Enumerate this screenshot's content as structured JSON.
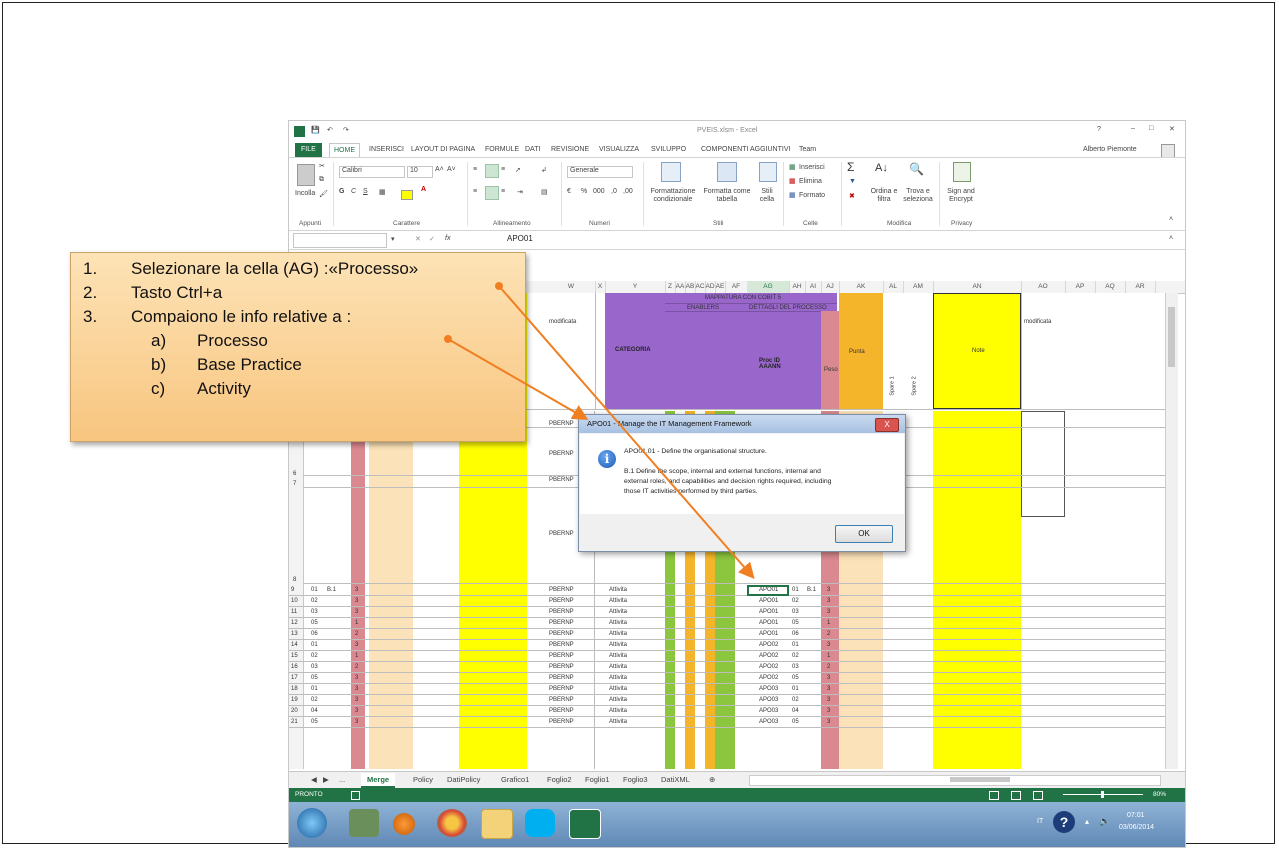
{
  "callout": {
    "items": [
      {
        "num": "1.",
        "text": "Selezionare la cella (AG) :«Processo»"
      },
      {
        "num": "2.",
        "text": "Tasto Ctrl+a"
      },
      {
        "num": "3.",
        "text": "Compaiono le info relative a :"
      }
    ],
    "subitems": [
      {
        "letter": "a)",
        "text": "Processo"
      },
      {
        "letter": "b)",
        "text": "Base Practice"
      },
      {
        "letter": "c)",
        "text": "Activity"
      }
    ]
  },
  "excel": {
    "window_title": "PVEIS.xlsm - Excel",
    "user": "Alberto Piemonte",
    "ribbon_tabs": [
      "FILE",
      "HOME",
      "INSERISCI",
      "LAYOUT DI PAGINA",
      "FORMULE",
      "DATI",
      "REVISIONE",
      "VISUALIZZA",
      "SVILUPPO",
      "COMPONENTI AGGIUNTIVI",
      "Team"
    ],
    "font_name": "Calibri",
    "font_size": "10",
    "number_format": "Generale",
    "group_labels": [
      "Appunti",
      "Carattere",
      "Allineamento",
      "Numeri",
      "Stili",
      "Celle",
      "Modifica",
      "Privacy"
    ],
    "ribbon_buttons": {
      "paste": "Incolla",
      "conditional": "Formattazione condizionale",
      "format_table": "Formatta come tabella",
      "cell_styles": "Stili cella",
      "insert": "Inserisci",
      "delete": "Elimina",
      "format": "Formato",
      "sort": "Ordina e filtra",
      "find": "Trova e seleziona",
      "sign": "Sign and Encrypt"
    },
    "name_box": "",
    "formula": "APO01",
    "fx": "fx",
    "columns": [
      "W",
      "X",
      "Y",
      "Z",
      "AA",
      "AB",
      "AC",
      "AD",
      "AE",
      "AF",
      "AG",
      "AH",
      "AI",
      "AJ",
      "AK",
      "AL",
      "AM",
      "AN",
      "AO",
      "AP",
      "AQ",
      "AR"
    ],
    "header_labels": {
      "mappatura": "MAPPATURA CON COBIT 5",
      "enablers": "ENABLERS",
      "dettagli": "DETTAGLI DEL PROCESSO",
      "modificata1": "modificata",
      "categoria": "CATEGORIA",
      "proc_id": "Proc ID AAANN",
      "peso": "Peso",
      "punta": "Punta",
      "note": "Note",
      "modificata2": "modificata",
      "spare1": "Spare 1",
      "spare2": "Spare 2"
    },
    "rows": [
      {
        "n": "9",
        "a": "01",
        "b": "B.1",
        "c": "3",
        "w": "PBERNP",
        "y": "Attivita",
        "ag": "APO01",
        "ah": "01",
        "ai": "B.1",
        "aj": "3"
      },
      {
        "n": "10",
        "a": "02",
        "b": "",
        "c": "3",
        "w": "PBERNP",
        "y": "Attivita",
        "ag": "APO01",
        "ah": "02",
        "ai": "",
        "aj": "3"
      },
      {
        "n": "11",
        "a": "03",
        "b": "",
        "c": "3",
        "w": "PBERNP",
        "y": "Attivita",
        "ag": "APO01",
        "ah": "03",
        "ai": "",
        "aj": "3"
      },
      {
        "n": "12",
        "a": "05",
        "b": "",
        "c": "1",
        "w": "PBERNP",
        "y": "Attivita",
        "ag": "APO01",
        "ah": "05",
        "ai": "",
        "aj": "1"
      },
      {
        "n": "13",
        "a": "06",
        "b": "",
        "c": "2",
        "w": "PBERNP",
        "y": "Attivita",
        "ag": "APO01",
        "ah": "06",
        "ai": "",
        "aj": "2"
      },
      {
        "n": "14",
        "a": "01",
        "b": "",
        "c": "3",
        "w": "PBERNP",
        "y": "Attivita",
        "ag": "APO02",
        "ah": "01",
        "ai": "",
        "aj": "3"
      },
      {
        "n": "15",
        "a": "02",
        "b": "",
        "c": "1",
        "w": "PBERNP",
        "y": "Attivita",
        "ag": "APO02",
        "ah": "02",
        "ai": "",
        "aj": "1"
      },
      {
        "n": "16",
        "a": "03",
        "b": "",
        "c": "2",
        "w": "PBERNP",
        "y": "Attivita",
        "ag": "APO02",
        "ah": "03",
        "ai": "",
        "aj": "2"
      },
      {
        "n": "17",
        "a": "05",
        "b": "",
        "c": "3",
        "w": "PBERNP",
        "y": "Attivita",
        "ag": "APO02",
        "ah": "05",
        "ai": "",
        "aj": "3"
      },
      {
        "n": "18",
        "a": "01",
        "b": "",
        "c": "3",
        "w": "PBERNP",
        "y": "Attivita",
        "ag": "APO03",
        "ah": "01",
        "ai": "",
        "aj": "3"
      },
      {
        "n": "19",
        "a": "02",
        "b": "",
        "c": "3",
        "w": "PBERNP",
        "y": "Attivita",
        "ag": "APO03",
        "ah": "02",
        "ai": "",
        "aj": "3"
      },
      {
        "n": "20",
        "a": "04",
        "b": "",
        "c": "3",
        "w": "PBERNP",
        "y": "Attivita",
        "ag": "APO03",
        "ah": "04",
        "ai": "",
        "aj": "3"
      },
      {
        "n": "21",
        "a": "05",
        "b": "",
        "c": "3",
        "w": "PBERNP",
        "y": "Attivita",
        "ag": "APO03",
        "ah": "05",
        "ai": "",
        "aj": "3"
      }
    ],
    "upper_row_numbers": [
      "6",
      "7",
      "8"
    ],
    "upper_w": [
      "PBERNP",
      "PBERNP",
      "PBERNP",
      "PBERNP"
    ],
    "sheet_tabs": [
      "...",
      "Merge",
      "Policy",
      "DatiPolicy",
      "Grafico1",
      "Foglio2",
      "Foglio1",
      "Foglio3",
      "DatiXML"
    ],
    "active_sheet": "Merge",
    "status": "PRONTO",
    "zoom": "80%",
    "clock_time": "07:01",
    "clock_date": "03/06/2014",
    "lang": "IT"
  },
  "dialog": {
    "title": "APO01 - Manage the IT Management Framework",
    "line1": "APO01.01 - Define the organisational structure.",
    "line2": "B.1 Define the scope, internal and external functions, internal and",
    "line3": "external roles, and capabilities and decision rights required, including",
    "line4": "those IT activities performed by third parties.",
    "ok": "OK",
    "close": "X"
  },
  "colors": {
    "excel_green": "#217346",
    "yellow": "#ffff00",
    "purple": "#9966cc",
    "pink": "#d9898f",
    "tan": "#fbe2b8",
    "orange": "#f5b52b",
    "green": "#8cc63f",
    "callout_fill": "#f8c57f",
    "arrow": "#f07f22"
  }
}
